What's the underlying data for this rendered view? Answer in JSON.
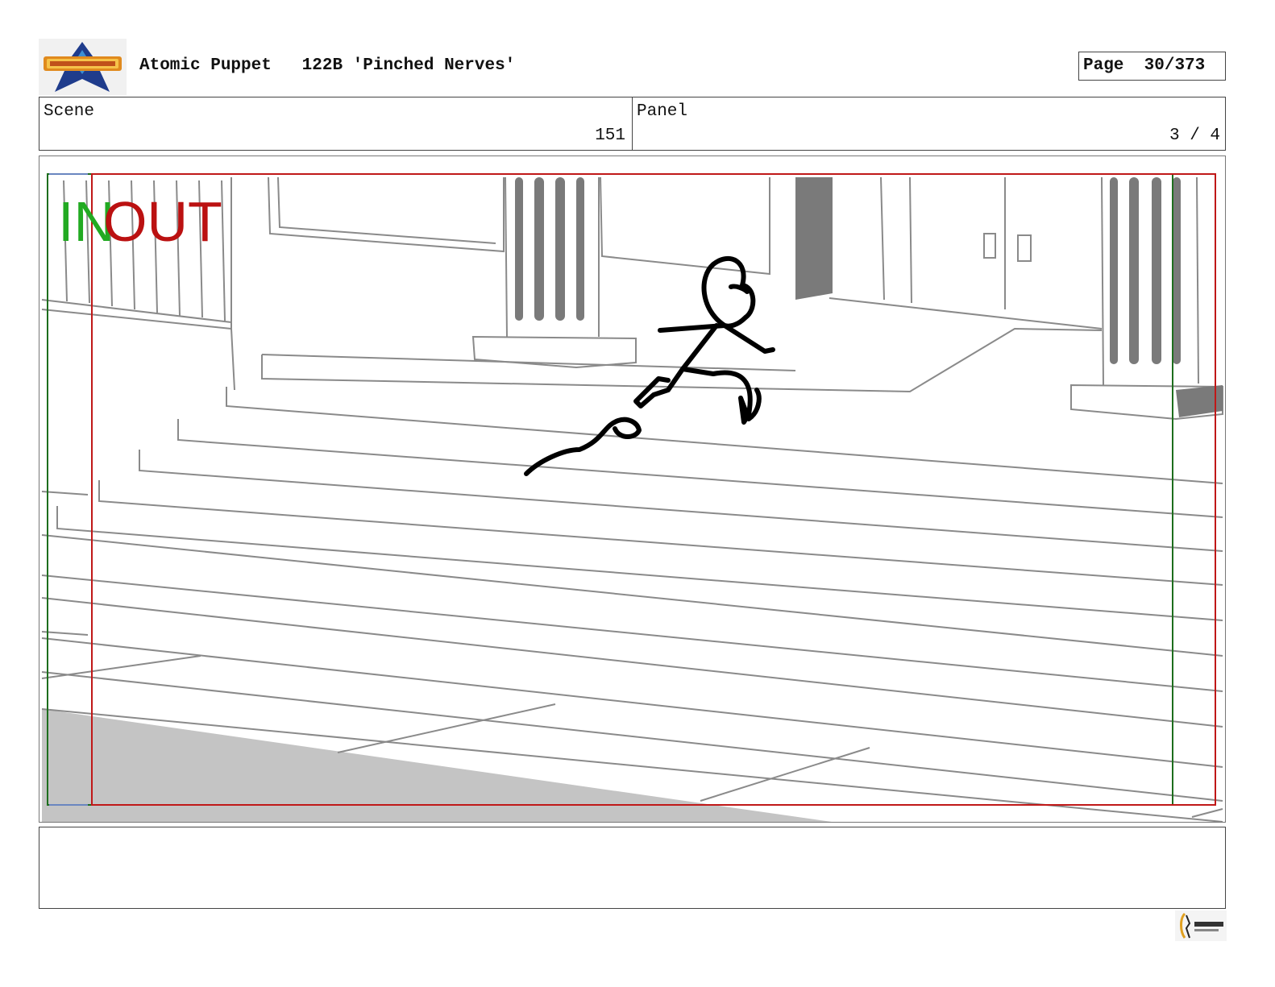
{
  "header": {
    "show_name": "Atomic Puppet",
    "episode": "122B 'Pinched Nerves'",
    "page_label": "Page",
    "page_value": "30/373"
  },
  "scene": {
    "label": "Scene",
    "value": "151"
  },
  "panel": {
    "label": "Panel",
    "value": "3 / 4"
  },
  "overlay": {
    "in_label": "IN",
    "out_label": "OUT",
    "in_color": "#22aa22",
    "out_color": "#bb1111"
  },
  "colors": {
    "safe_frame_green": "#1e6e1e",
    "safe_frame_red": "#c01818",
    "line_gray": "#8a8a8a",
    "shadow_gray": "#c4c4c4"
  },
  "icons": [
    "atomic-puppet-logo",
    "mercury-filmworks-logo"
  ]
}
